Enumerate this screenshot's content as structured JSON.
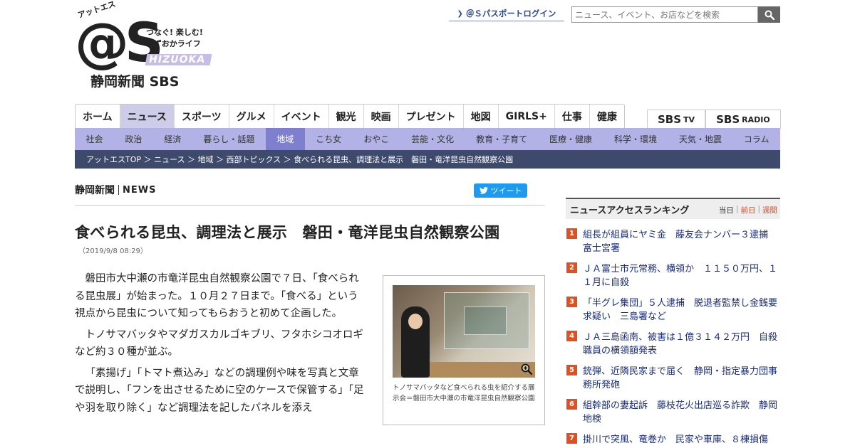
{
  "header": {
    "logo_kana": "アットエス",
    "logo_mark": "@S",
    "logo_tagline_1": "つなぐ! 楽しむ!",
    "logo_tagline_2": "しずおかライフ",
    "logo_shizuoka": "HIZUOKA",
    "logo_paper": "静岡新聞 SBS",
    "passport_login": "＠Ｓパスポートログイン",
    "search_placeholder": "ニュース、イベント、お店などを検索"
  },
  "main_nav": [
    {
      "label": "ホーム",
      "active": false
    },
    {
      "label": "ニュース",
      "active": true
    },
    {
      "label": "スポーツ",
      "active": false
    },
    {
      "label": "グルメ",
      "active": false
    },
    {
      "label": "イベント",
      "active": false
    },
    {
      "label": "観光",
      "active": false
    },
    {
      "label": "映画",
      "active": false
    },
    {
      "label": "プレゼント",
      "active": false
    },
    {
      "label": "地図",
      "active": false
    },
    {
      "label": "GIRLS+",
      "active": false
    },
    {
      "label": "仕事",
      "active": false
    },
    {
      "label": "健康",
      "active": false
    }
  ],
  "brands": {
    "sbs_tv": "SBS",
    "sbs_tv_suffix": "TV",
    "sbs_radio": "SBS",
    "sbs_radio_suffix": "RADIO"
  },
  "sub_nav": [
    {
      "label": "社会",
      "active": false
    },
    {
      "label": "政治",
      "active": false
    },
    {
      "label": "経済",
      "active": false
    },
    {
      "label": "暮らし・話題",
      "active": false
    },
    {
      "label": "地域",
      "active": true
    },
    {
      "label": "こち女",
      "active": false
    },
    {
      "label": "おやこ",
      "active": false
    },
    {
      "label": "芸能・文化",
      "active": false
    },
    {
      "label": "教育・子育て",
      "active": false
    },
    {
      "label": "医療・健康",
      "active": false
    },
    {
      "label": "科学・環境",
      "active": false
    },
    {
      "label": "天気・地震",
      "active": false
    },
    {
      "label": "コラム",
      "active": false
    }
  ],
  "breadcrumb": "アットエスTOP ＞ ニュース ＞ 地域 ＞ 西部トピックス ＞ 食べられる昆虫、調理法と展示　磐田・竜洋昆虫自然観察公園",
  "article": {
    "source_name": "静岡新聞",
    "source_label": "NEWS",
    "tweet_label": "ツイート",
    "headline": "食べられる昆虫、調理法と展示　磐田・竜洋昆虫自然観察公園",
    "date": "（2019/9/8 08:29）",
    "paragraphs": [
      "磐田市大中瀬の市竜洋昆虫自然観察公園で７日、「食べられる昆虫展」が始まった。１０月２７日まで。「食べる」という視点から昆虫について知ってもらおうと初めて企画した。",
      "トノサマバッタやマダガスカルゴキブリ、フタホシコオロギなど約３０種が並ぶ。",
      "「素揚げ」「トマト煮込み」などの調理例や味を写真と文章で説明し、「フンを出させるために空のケースで保管する」「足や羽を取り除く」など調理法を記したパネルを添え"
    ],
    "photo_caption": "トノサマバッタなど食べられる虫を紹介する展示会＝磐田市大中瀬の市竜洋昆虫自然観察公園"
  },
  "ranking": {
    "title": "ニュースアクセスランキング",
    "tab_day": "当日",
    "tab_prev": "前日",
    "tab_week": "週間",
    "items": [
      {
        "rank": "1",
        "text": "組長が組員にヤミ金　藤友会ナンバー３逮捕　富士宮署"
      },
      {
        "rank": "2",
        "text": "ＪＡ富士市元常務、横領か　１１５０万円、１１月に自殺"
      },
      {
        "rank": "3",
        "text": "「半グレ集団」５人逮捕　脱退者監禁し金銭要求疑い　三島署など"
      },
      {
        "rank": "4",
        "text": "ＪＡ三島函南、被害は１億３１４２万円　自殺職員の横領額発表"
      },
      {
        "rank": "5",
        "text": "銃弾、近隣民家まで届く　静岡・指定暴力団事務所発砲"
      },
      {
        "rank": "6",
        "text": "組幹部の妻起訴　藤枝花火出店巡る詐欺　静岡地検"
      },
      {
        "rank": "7",
        "text": "掛川で突風、竜巻か　民家や車庫、８棟損傷"
      }
    ]
  },
  "colors": {
    "subnav_bg": "#b2b2e6",
    "subnav_active": "#7f7fd0",
    "breadcrumb_bg": "#3e4a6b",
    "rank_badge": "#e1501e",
    "link_blue": "#1a2d7a"
  }
}
